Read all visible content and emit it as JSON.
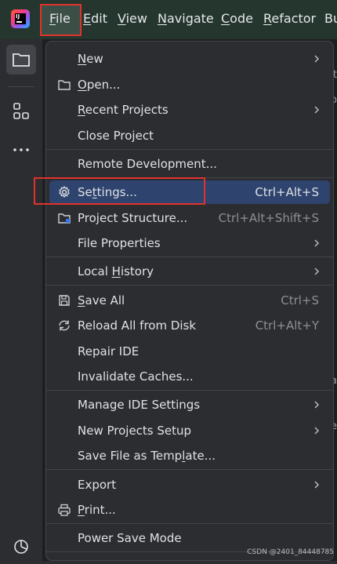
{
  "menubar": {
    "items": [
      "File",
      "Edit",
      "View",
      "Navigate",
      "Code",
      "Refactor",
      "Bu"
    ],
    "mnemonics": [
      "F",
      "E",
      "V",
      "N",
      "C",
      "R",
      ""
    ]
  },
  "file_menu": {
    "items": [
      {
        "label": "New",
        "mnemonic": "N",
        "submenu": true
      },
      {
        "label": "Open...",
        "mnemonic": "O",
        "icon": "folder-icon"
      },
      {
        "label": "Recent Projects",
        "mnemonic": "R",
        "submenu": true
      },
      {
        "label": "Close Project"
      },
      {
        "label": "Remote Development..."
      },
      {
        "label": "Settings...",
        "mnemonic": "t",
        "shortcut": "Ctrl+Alt+S",
        "icon": "gear-icon",
        "selected": true
      },
      {
        "label": "Project Structure...",
        "shortcut": "Ctrl+Alt+Shift+S",
        "icon": "project-structure-icon"
      },
      {
        "label": "File Properties",
        "submenu": true
      },
      {
        "label": "Local History",
        "mnemonic": "H",
        "submenu": true
      },
      {
        "label": "Save All",
        "mnemonic": "S",
        "shortcut": "Ctrl+S",
        "icon": "save-icon"
      },
      {
        "label": "Reload All from Disk",
        "shortcut": "Ctrl+Alt+Y",
        "icon": "reload-icon"
      },
      {
        "label": "Repair IDE"
      },
      {
        "label": "Invalidate Caches..."
      },
      {
        "label": "Manage IDE Settings",
        "submenu": true
      },
      {
        "label": "New Projects Setup",
        "submenu": true
      },
      {
        "label": "Save File as Template...",
        "mnemonic": "l"
      },
      {
        "label": "Export",
        "submenu": true
      },
      {
        "label": "Print...",
        "mnemonic": "P",
        "icon": "print-icon"
      },
      {
        "label": "Power Save Mode"
      }
    ]
  },
  "watermark": "CSDN @2401_84448785",
  "colors": {
    "selection": "#2e436e",
    "highlight_box": "#e0322c",
    "menubar": "#24362e"
  }
}
